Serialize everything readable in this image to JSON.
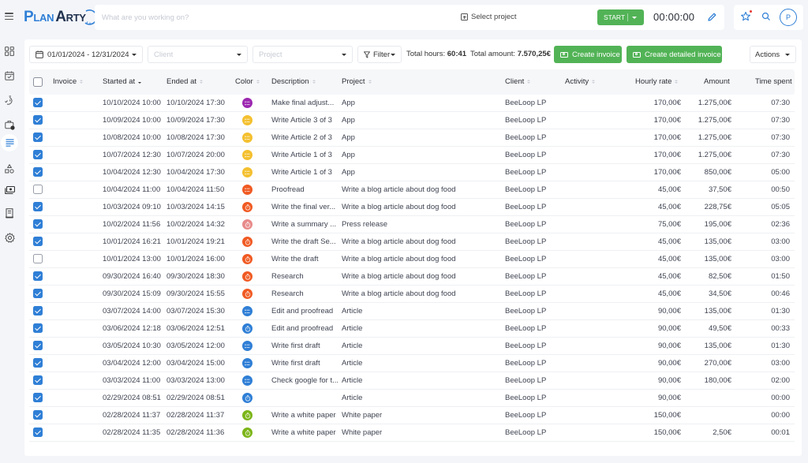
{
  "app": {
    "brand_left": "Plan",
    "brand_right": "Arty",
    "timer_placeholder": "What are you working on?",
    "select_project_label": "Select project",
    "start_label": "START",
    "timer_value": "00:00:00",
    "avatar_initial": "P"
  },
  "sidebar": {
    "items": [
      {
        "name": "dashboard",
        "icon": "grid-icon"
      },
      {
        "name": "calendar",
        "icon": "calendar-check-icon"
      },
      {
        "name": "time-tracking",
        "icon": "stopwatch-icon"
      },
      {
        "name": "projects",
        "icon": "briefcase-clock-icon"
      },
      {
        "name": "timesheet",
        "icon": "list-lines-icon",
        "active": true
      },
      {
        "name": "shapes",
        "icon": "shapes-icon"
      },
      {
        "name": "billing",
        "icon": "money-icon"
      },
      {
        "name": "invoices",
        "icon": "receipt-icon"
      },
      {
        "name": "settings",
        "icon": "gear-icon"
      }
    ]
  },
  "filters": {
    "date_range": "01/01/2024 - 12/31/2024",
    "client_placeholder": "Client",
    "project_placeholder": "Project",
    "filter_label": "Filter",
    "total_hours_label": "Total hours:",
    "total_hours_value": "60:41",
    "total_amount_label": "Total amount:",
    "total_amount_value": "7.570,25€",
    "create_invoice_label": "Create invoice",
    "create_detailed_invoice_label": "Create detailed invoice",
    "actions_label": "Actions"
  },
  "colors": {
    "accent": "#2f7fd6",
    "green": "#52b356",
    "purple": "#9c27b0",
    "yellow": "#f4c02f",
    "orange": "#f05a22",
    "pink": "#e88a8a",
    "blue": "#2f7fd6",
    "lime": "#7cb518"
  },
  "table": {
    "headers": {
      "invoice": "Invoice",
      "started_at": "Started at",
      "ended_at": "Ended at",
      "color": "Color",
      "description": "Description",
      "project": "Project",
      "client": "Client",
      "activity": "Activity",
      "hourly_rate": "Hourly rate",
      "amount": "Amount",
      "time_spent": "Time spent"
    },
    "rows": [
      {
        "checked": true,
        "started": "10/10/2024  10:00",
        "ended": "10/10/2024  17:30",
        "color": "purple",
        "icon": "list",
        "description": "Make final adjust...",
        "project": "App",
        "client": "BeeLoop LP",
        "activity": "",
        "rate": "170,00€",
        "amount": "1.275,00€",
        "time": "07:30"
      },
      {
        "checked": true,
        "started": "10/09/2024  10:00",
        "ended": "10/09/2024  17:30",
        "color": "yellow",
        "icon": "list",
        "description": "Write Article 3 of 3",
        "project": "App",
        "client": "BeeLoop LP",
        "activity": "",
        "rate": "170,00€",
        "amount": "1.275,00€",
        "time": "07:30"
      },
      {
        "checked": true,
        "started": "10/08/2024  10:00",
        "ended": "10/08/2024  17:30",
        "color": "yellow",
        "icon": "list",
        "description": "Write Article 2 of 3",
        "project": "App",
        "client": "BeeLoop LP",
        "activity": "",
        "rate": "170,00€",
        "amount": "1.275,00€",
        "time": "07:30"
      },
      {
        "checked": true,
        "started": "10/07/2024  12:30",
        "ended": "10/07/2024  20:00",
        "color": "yellow",
        "icon": "list",
        "description": "Write Article 1 of 3",
        "project": "App",
        "client": "BeeLoop LP",
        "activity": "",
        "rate": "170,00€",
        "amount": "1.275,00€",
        "time": "07:30"
      },
      {
        "checked": true,
        "started": "10/04/2024  12:30",
        "ended": "10/04/2024  17:30",
        "color": "yellow",
        "icon": "list",
        "description": "Write Article 1 of 3",
        "project": "App",
        "client": "BeeLoop LP",
        "activity": "",
        "rate": "170,00€",
        "amount": "850,00€",
        "time": "05:00"
      },
      {
        "checked": false,
        "started": "10/04/2024  11:00",
        "ended": "10/04/2024  11:50",
        "color": "orange",
        "icon": "list",
        "description": "Proofread",
        "project": "Write a blog article about dog food",
        "client": "BeeLoop LP",
        "activity": "",
        "rate": "45,00€",
        "amount": "37,50€",
        "time": "00:50"
      },
      {
        "checked": true,
        "started": "10/03/2024  09:10",
        "ended": "10/03/2024  14:15",
        "color": "orange",
        "icon": "timer",
        "description": "Write the final ver...",
        "project": "Write a blog article about dog food",
        "client": "BeeLoop LP",
        "activity": "",
        "rate": "45,00€",
        "amount": "228,75€",
        "time": "05:05"
      },
      {
        "checked": true,
        "started": "10/02/2024  11:56",
        "ended": "10/02/2024  14:32",
        "color": "pink",
        "icon": "timer",
        "description": "Write a summary ...",
        "project": "Press release",
        "client": "BeeLoop LP",
        "activity": "",
        "rate": "75,00€",
        "amount": "195,00€",
        "time": "02:36"
      },
      {
        "checked": true,
        "started": "10/01/2024  16:21",
        "ended": "10/01/2024  19:21",
        "color": "orange",
        "icon": "timer",
        "description": "Write the draft Se...",
        "project": "Write a blog article about dog food",
        "client": "BeeLoop LP",
        "activity": "",
        "rate": "45,00€",
        "amount": "135,00€",
        "time": "03:00"
      },
      {
        "checked": false,
        "started": "10/01/2024  13:00",
        "ended": "10/01/2024  16:00",
        "color": "orange",
        "icon": "timer",
        "description": "Write the draft",
        "project": "Write a blog article about dog food",
        "client": "BeeLoop LP",
        "activity": "",
        "rate": "45,00€",
        "amount": "135,00€",
        "time": "03:00"
      },
      {
        "checked": true,
        "started": "09/30/2024  16:40",
        "ended": "09/30/2024  18:30",
        "color": "orange",
        "icon": "timer",
        "description": "Research",
        "project": "Write a blog article about dog food",
        "client": "BeeLoop LP",
        "activity": "",
        "rate": "45,00€",
        "amount": "82,50€",
        "time": "01:50"
      },
      {
        "checked": true,
        "started": "09/30/2024  15:09",
        "ended": "09/30/2024  15:55",
        "color": "orange",
        "icon": "timer",
        "description": "Research",
        "project": "Write a blog article about dog food",
        "client": "BeeLoop LP",
        "activity": "",
        "rate": "45,00€",
        "amount": "34,50€",
        "time": "00:46"
      },
      {
        "checked": true,
        "started": "03/07/2024  14:00",
        "ended": "03/07/2024  15:30",
        "color": "blue",
        "icon": "list",
        "description": "Edit and proofread",
        "project": "Article",
        "client": "BeeLoop LP",
        "activity": "",
        "rate": "90,00€",
        "amount": "135,00€",
        "time": "01:30"
      },
      {
        "checked": true,
        "started": "03/06/2024  12:18",
        "ended": "03/06/2024  12:51",
        "color": "blue",
        "icon": "timer",
        "description": "Edit and proofread",
        "project": "Article",
        "client": "BeeLoop LP",
        "activity": "",
        "rate": "90,00€",
        "amount": "49,50€",
        "time": "00:33"
      },
      {
        "checked": true,
        "started": "03/05/2024  10:30",
        "ended": "03/05/2024  12:00",
        "color": "blue",
        "icon": "list",
        "description": "Write first draft",
        "project": "Article",
        "client": "BeeLoop LP",
        "activity": "",
        "rate": "90,00€",
        "amount": "135,00€",
        "time": "01:30"
      },
      {
        "checked": true,
        "started": "03/04/2024  12:00",
        "ended": "03/04/2024  15:00",
        "color": "blue",
        "icon": "list",
        "description": "Write first draft",
        "project": "Article",
        "client": "BeeLoop LP",
        "activity": "",
        "rate": "90,00€",
        "amount": "270,00€",
        "time": "03:00"
      },
      {
        "checked": true,
        "started": "03/03/2024  11:00",
        "ended": "03/03/2024  13:00",
        "color": "blue",
        "icon": "list",
        "description": "Check google for t...",
        "project": "Article",
        "client": "BeeLoop LP",
        "activity": "",
        "rate": "90,00€",
        "amount": "180,00€",
        "time": "02:00"
      },
      {
        "checked": true,
        "started": "02/29/2024  08:51",
        "ended": "02/29/2024  08:51",
        "color": "blue",
        "icon": "timer",
        "description": "",
        "project": "Article",
        "client": "BeeLoop LP",
        "activity": "",
        "rate": "90,00€",
        "amount": "",
        "time": "00:00"
      },
      {
        "checked": true,
        "started": "02/28/2024  11:37",
        "ended": "02/28/2024  11:37",
        "color": "lime",
        "icon": "timer",
        "description": "Write a white paper",
        "project": "White paper",
        "client": "BeeLoop LP",
        "activity": "",
        "rate": "150,00€",
        "amount": "",
        "time": "00:00"
      },
      {
        "checked": true,
        "started": "02/28/2024  11:35",
        "ended": "02/28/2024  11:36",
        "color": "lime",
        "icon": "timer",
        "description": "Write a white paper",
        "project": "White paper",
        "client": "BeeLoop LP",
        "activity": "",
        "rate": "150,00€",
        "amount": "2,50€",
        "time": "00:01"
      }
    ]
  }
}
